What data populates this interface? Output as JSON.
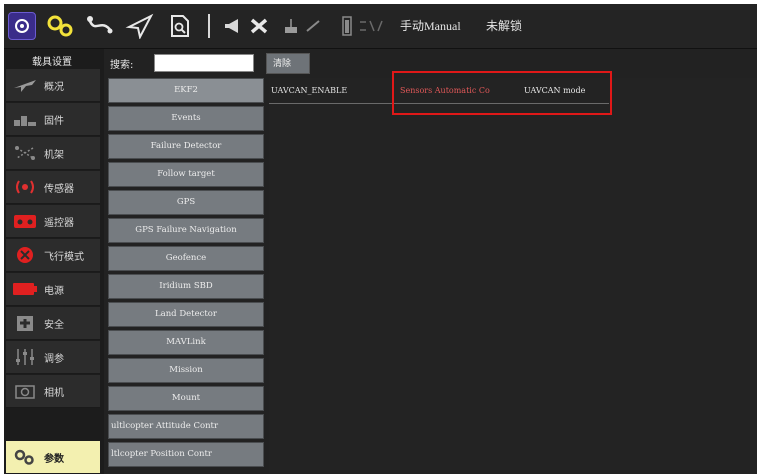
{
  "toolbar": {
    "items": [
      {
        "name": "qgc-logo-icon"
      },
      {
        "name": "settings-gears-icon"
      },
      {
        "name": "plan-route-icon"
      },
      {
        "name": "fly-send-icon"
      },
      {
        "name": "analyze-document-icon"
      }
    ],
    "flight_mode": "手动Manual",
    "arm_status": "未解锁"
  },
  "nav": {
    "title": "载具设置",
    "items": [
      {
        "label": "概况",
        "icon": "plane-icon",
        "active": false
      },
      {
        "label": "固件",
        "icon": "firmware-icon",
        "active": false
      },
      {
        "label": "机架",
        "icon": "airframe-icon",
        "active": false
      },
      {
        "label": "传感器",
        "icon": "sensors-icon",
        "active": false
      },
      {
        "label": "遥控器",
        "icon": "radio-icon",
        "active": false
      },
      {
        "label": "飞行模式",
        "icon": "flight-modes-icon",
        "active": false
      },
      {
        "label": "电源",
        "icon": "battery-icon",
        "active": false
      },
      {
        "label": "安全",
        "icon": "safety-icon",
        "active": false
      },
      {
        "label": "调参",
        "icon": "tuning-icon",
        "active": false
      },
      {
        "label": "相机",
        "icon": "camera-icon",
        "active": false
      },
      {
        "label": "参数",
        "icon": "parameters-icon",
        "active": true
      }
    ]
  },
  "search": {
    "label": "搜索:",
    "value": "",
    "clear_label": "清除"
  },
  "groups": [
    "EKF2",
    "Events",
    "Failure Detector",
    "Follow target",
    "GPS",
    "GPS Failure Navigation",
    "Geofence",
    "Iridium SBD",
    "Land Detector",
    "MAVLink",
    "Mission",
    "Mount",
    "ultlcopter Attitude Contr",
    "ltlcopter Position Contr"
  ],
  "selected_group": "EKF2",
  "params": [
    {
      "name": "UAVCAN_ENABLE",
      "value": "Sensors Automatic Co",
      "description": "UAVCAN mode"
    }
  ],
  "colors": {
    "background": "#222222",
    "nav_active": "#f3f0b0",
    "group_button": "#767b80",
    "param_value_modified": "#e05858",
    "highlight": "#e01818"
  }
}
